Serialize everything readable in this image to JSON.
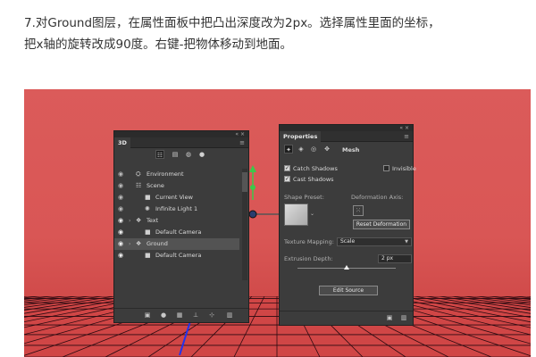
{
  "article": {
    "line1": "7.对Ground图层，在属性面板中把凸出深度改为2px。选择属性里面的坐标，",
    "line2": "把x轴的旋转改成90度。右键-把物体移动到地面。"
  },
  "colors": {
    "background_top": "#db5b5a",
    "background_bottom": "#c8403f",
    "grid_line": "#2a0a10",
    "panel_bg": "#3c3c3c",
    "gizmo_green": "#3cc84a",
    "axis_blue": "#2233ee"
  },
  "panel_3d": {
    "tab": "3D",
    "window_controls": "«  ×",
    "filter_icons": [
      "layers-icon",
      "mesh-icon",
      "material-icon",
      "light-icon"
    ],
    "items": [
      {
        "label": "Environment",
        "icon": "environment-icon",
        "expand": false,
        "selected": false,
        "eye_bright": false
      },
      {
        "label": "Scene",
        "icon": "scene-icon",
        "expand": false,
        "selected": false,
        "eye_bright": false
      },
      {
        "label": "Current View",
        "icon": "camera-icon",
        "expand": false,
        "selected": false,
        "eye_bright": false
      },
      {
        "label": "Infinite Light 1",
        "icon": "light-icon",
        "expand": false,
        "selected": false,
        "eye_bright": false
      },
      {
        "label": "Text",
        "icon": "mesh-icon",
        "expand": true,
        "selected": false,
        "eye_bright": true
      },
      {
        "label": "Default Camera",
        "icon": "camera-icon",
        "expand": false,
        "selected": false,
        "eye_bright": true
      },
      {
        "label": "Ground",
        "icon": "mesh-icon",
        "expand": true,
        "selected": true,
        "eye_bright": true
      },
      {
        "label": "Default Camera",
        "icon": "camera-icon",
        "expand": false,
        "selected": false,
        "eye_bright": true
      }
    ],
    "bottom_icons": [
      "add-object-icon",
      "add-light-icon",
      "render-icon",
      "add-constraint-icon",
      "add-anchor-icon",
      "delete-icon"
    ]
  },
  "properties_panel": {
    "tab": "Properties",
    "window_controls": "«  ×",
    "mode_label": "Mesh",
    "catch_shadows": {
      "label": "Catch Shadows",
      "checked": true
    },
    "invisible": {
      "label": "Invisible",
      "checked": false
    },
    "cast_shadows": {
      "label": "Cast Shadows",
      "checked": true
    },
    "shape_preset_label": "Shape Preset:",
    "deformation_axis_label": "Deformation Axis:",
    "reset_button": "Reset Deformation",
    "texture_mapping_label": "Texture Mapping:",
    "texture_mapping_value": "Scale",
    "extrusion_depth_label": "Extrusion Depth:",
    "extrusion_depth_value": "2 px",
    "extrusion_slider_fraction": 0.5,
    "edit_source_button": "Edit Source"
  }
}
